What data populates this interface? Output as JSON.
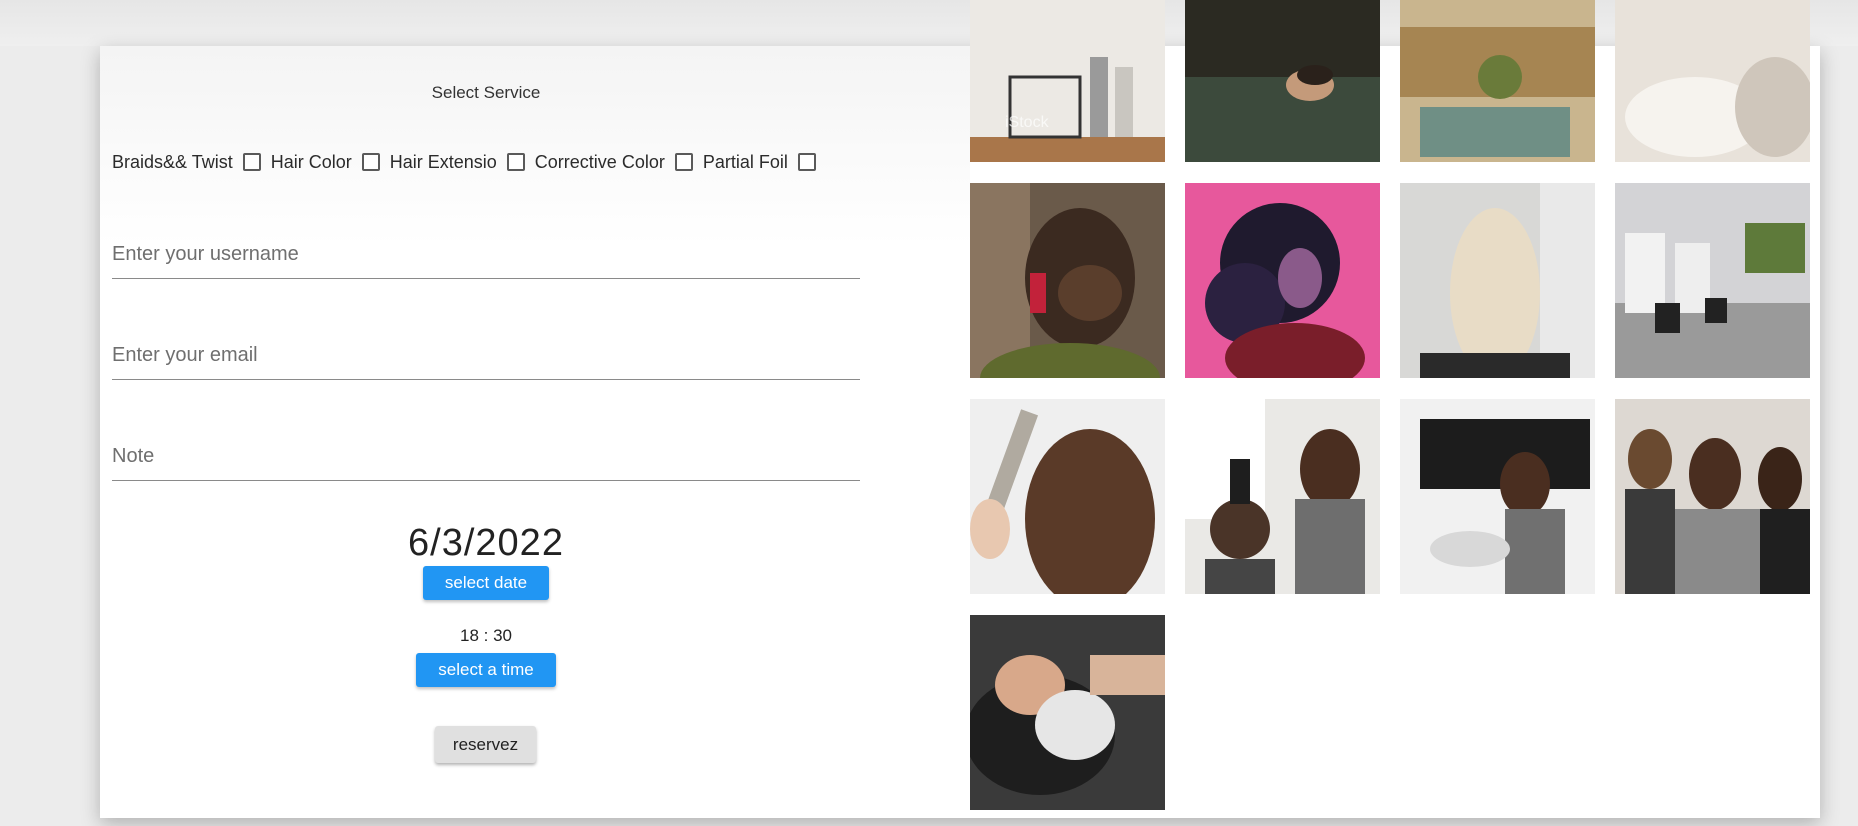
{
  "form": {
    "service_title": "Select Service",
    "services": [
      {
        "label": "Braids&& Twist",
        "checked": false
      },
      {
        "label": "Hair Color",
        "checked": false
      },
      {
        "label": "Hair Extensio",
        "checked": false
      },
      {
        "label": "Corrective Color",
        "checked": false
      },
      {
        "label": "Partial Foil",
        "checked": false
      }
    ],
    "username_placeholder": "Enter your username",
    "email_placeholder": "Enter your email",
    "note_placeholder": "Note",
    "date_value": "6/3/2022",
    "select_date_label": "select date",
    "time_value": "18 : 30",
    "select_time_label": "select a time",
    "reserve_label": "reservez"
  },
  "gallery": {
    "images": [
      {
        "name": "salon-products-image",
        "watermark": "iStock"
      },
      {
        "name": "man-in-pool-image"
      },
      {
        "name": "spa-pool-image"
      },
      {
        "name": "robe-relax-image"
      },
      {
        "name": "braided-bun-image"
      },
      {
        "name": "curly-hair-pink-image"
      },
      {
        "name": "blonde-hair-styling-image"
      },
      {
        "name": "salon-interior-image"
      },
      {
        "name": "curling-iron-image"
      },
      {
        "name": "blow-dry-image"
      },
      {
        "name": "hair-wash-station-image"
      },
      {
        "name": "stylists-team-image"
      },
      {
        "name": "hair-shampoo-image"
      }
    ]
  }
}
